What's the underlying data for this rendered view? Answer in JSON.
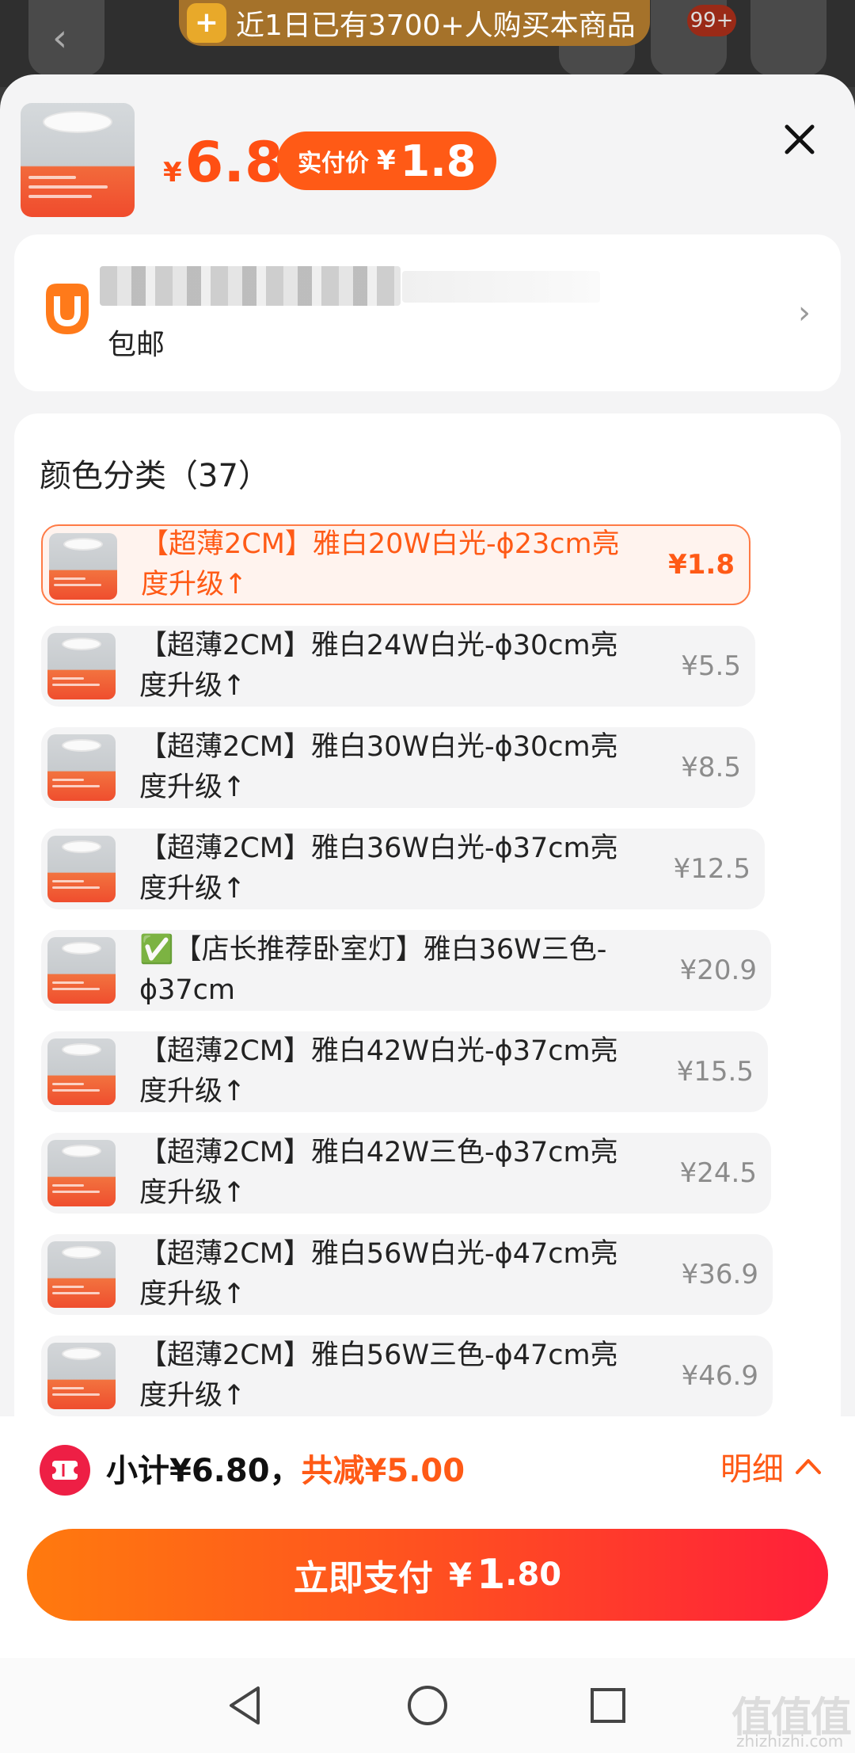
{
  "promo": {
    "text": "近1日已有3700+人购买本商品"
  },
  "header": {
    "badge": "99+"
  },
  "product": {
    "price_symbol": "¥",
    "price": "6.8",
    "real_price_label": "实付价",
    "real_price_symbol": "¥",
    "real_price": "1.8"
  },
  "shop": {
    "shipping": "包邮"
  },
  "variants": {
    "title": "颜色分类（37）",
    "items": [
      {
        "name": "【超薄2CM】雅白20W白光-ϕ23cm亮度升级↑",
        "price": "¥1.8",
        "selected": true
      },
      {
        "name": "【超薄2CM】雅白24W白光-ϕ30cm亮度升级↑",
        "price": "¥5.5"
      },
      {
        "name": "【超薄2CM】雅白30W白光-ϕ30cm亮度升级↑",
        "price": "¥8.5"
      },
      {
        "name": "【超薄2CM】雅白36W白光-ϕ37cm亮度升级↑",
        "price": "¥12.5"
      },
      {
        "name": "✅【店长推荐卧室灯】雅白36W三色-ϕ37cm",
        "price": "¥20.9"
      },
      {
        "name": "【超薄2CM】雅白42W白光-ϕ37cm亮度升级↑",
        "price": "¥15.5"
      },
      {
        "name": "【超薄2CM】雅白42W三色-ϕ37cm亮度升级↑",
        "price": "¥24.5"
      },
      {
        "name": "【超薄2CM】雅白56W白光-ϕ47cm亮度升级↑",
        "price": "¥36.9"
      },
      {
        "name": "【超薄2CM】雅白56W三色-ϕ47cm亮度升级↑",
        "price": "¥46.9"
      }
    ]
  },
  "summary": {
    "subtotal": "小计¥6.80，",
    "saved": "共减¥5.00",
    "details": "明细"
  },
  "pay": {
    "label": "立即支付",
    "symbol": "¥",
    "integer": "1",
    "decimal": ".80"
  },
  "watermark": {
    "logo": "值值值",
    "url": "zhizhizhi.com"
  },
  "colors": {
    "accent": "#ff5a16",
    "pay_start": "#ff7a0e",
    "pay_end": "#ff1f3a",
    "coupon": "#ee1f45"
  },
  "icons": [
    "back-icon",
    "share-icon",
    "cart-icon",
    "more-icon",
    "close-icon",
    "shop-logo-icon",
    "chevron-right-icon",
    "coupon-icon",
    "chevron-up-icon",
    "nav-back-icon",
    "nav-home-icon",
    "nav-recents-icon"
  ]
}
